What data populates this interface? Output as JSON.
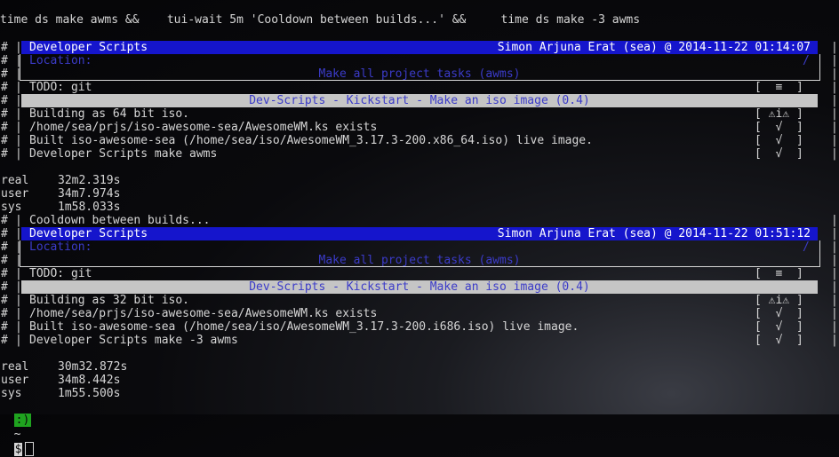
{
  "command": "time ds make awms &&    tui-wait 5m 'Cooldown between builds...' &&     time ds make -3 awms",
  "left_gutter": "#",
  "pipe": "|",
  "runs": [
    {
      "header_title": "Developer Scripts",
      "header_right": "Simon Arjuna Erat (sea) @ 2014-11-22 01:14:07",
      "location_label": "Location:",
      "location_path": "/",
      "location_desc": "Make all project tasks (awms)",
      "todo": "TODO: git",
      "todo_status": "[  ≡  ]",
      "section_title": "Dev-Scripts - Kickstart - Make an iso image (0.4)",
      "items": [
        {
          "text": "Building as 64 bit iso.",
          "status": "[ ⚠i⚠ ]"
        },
        {
          "text": "/home/sea/prjs/iso-awesome-sea/AwesomeWM.ks exists",
          "status": "[  √  ]"
        },
        {
          "text": "Built iso-awesome-sea (/home/sea/iso/AwesomeWM_3.17.3-200.x86_64.iso) live image.",
          "status": "[  √  ]"
        },
        {
          "text": "Developer Scripts make awms",
          "status": "[  √  ]"
        }
      ],
      "timing": [
        {
          "k": "real",
          "v": "32m2.319s"
        },
        {
          "k": "user",
          "v": "34m7.974s"
        },
        {
          "k": "sys",
          "v": "1m58.033s"
        }
      ]
    },
    {
      "header_title": "Developer Scripts",
      "header_right": "Simon Arjuna Erat (sea) @ 2014-11-22 01:51:12",
      "location_label": "Location:",
      "location_path": "/",
      "location_desc": "Make all project tasks (awms)",
      "todo": "TODO: git",
      "todo_status": "[  ≡  ]",
      "section_title": "Dev-Scripts - Kickstart - Make an iso image (0.4)",
      "items": [
        {
          "text": "Building as 32 bit iso.",
          "status": "[ ⚠i⚠ ]"
        },
        {
          "text": "/home/sea/prjs/iso-awesome-sea/AwesomeWM.ks exists",
          "status": "[  √  ]"
        },
        {
          "text": "Built iso-awesome-sea (/home/sea/iso/AwesomeWM_3.17.3-200.i686.iso) live image.",
          "status": "[  √  ]"
        },
        {
          "text": "Developer Scripts make -3 awms",
          "status": "[  √  ]"
        }
      ],
      "timing": [
        {
          "k": "real",
          "v": "30m32.872s"
        },
        {
          "k": "user",
          "v": "34m8.442s"
        },
        {
          "k": "sys",
          "v": "1m55.500s"
        }
      ]
    }
  ],
  "cooldown": "Cooldown between builds...",
  "prompt": {
    "badge": ":)",
    "path": "~",
    "symbol": "$"
  }
}
